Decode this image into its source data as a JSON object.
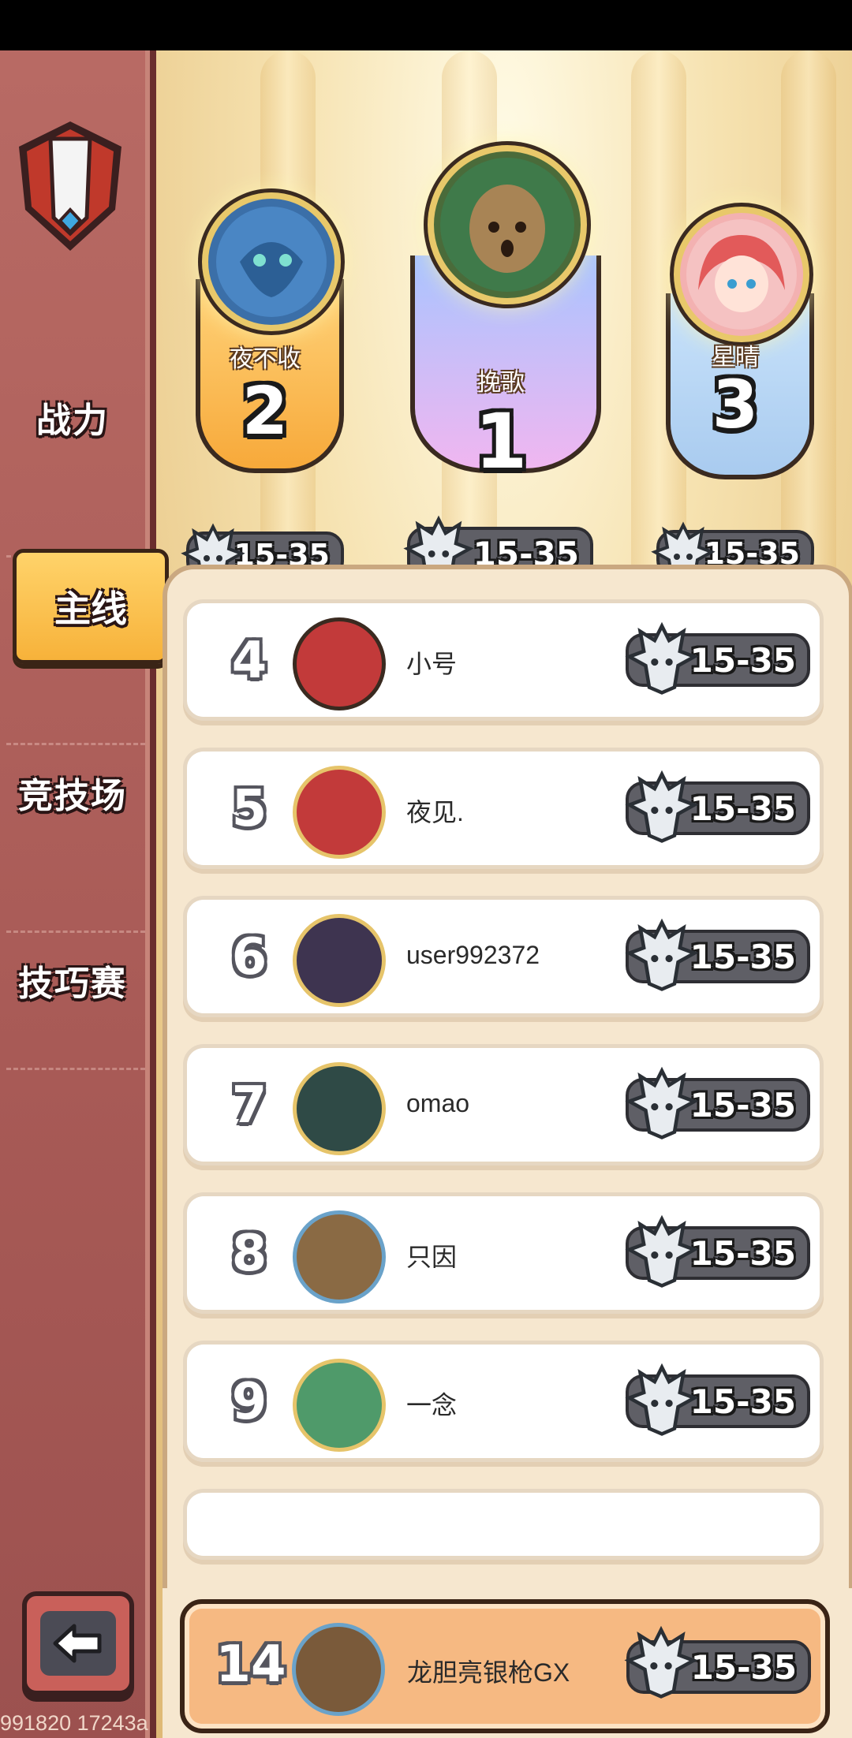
{
  "sidebar": {
    "items": [
      {
        "label": "战力"
      },
      {
        "label": "主线",
        "active": true
      },
      {
        "label": "竞技场"
      },
      {
        "label": "技巧赛"
      }
    ]
  },
  "podium": [
    {
      "place": "2",
      "name": "夜不收",
      "level": "15-35",
      "color": "#f8b63e"
    },
    {
      "place": "1",
      "name": "挽歌",
      "level": "15-35",
      "color": "#b8c8ff"
    },
    {
      "place": "3",
      "name": "星晴",
      "level": "15-35",
      "color": "#bcd9f4"
    }
  ],
  "ranking": [
    {
      "rank": "4",
      "name": "小号",
      "level": "15-35"
    },
    {
      "rank": "5",
      "name": "夜见.",
      "level": "15-35"
    },
    {
      "rank": "6",
      "name": "user992372",
      "level": "15-35"
    },
    {
      "rank": "7",
      "name": "omao",
      "level": "15-35"
    },
    {
      "rank": "8",
      "name": "只因",
      "level": "15-35"
    },
    {
      "rank": "9",
      "name": "一念",
      "level": "15-35"
    }
  ],
  "self": {
    "rank": "14",
    "name": "龙胆亮银枪GX",
    "level": "15-35"
  },
  "footer": {
    "version": "991820 17243a"
  },
  "icons": {
    "level_badge": "wolf-head-icon",
    "back": "back-arrow-icon"
  }
}
